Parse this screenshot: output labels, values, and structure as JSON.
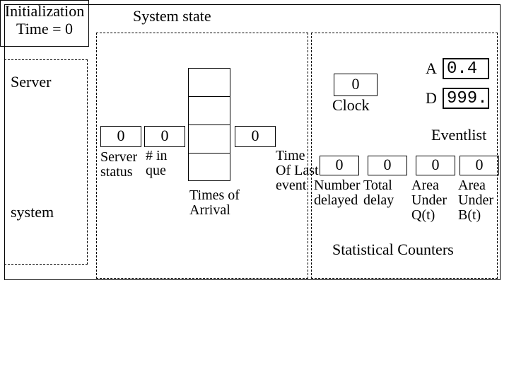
{
  "init": {
    "line1": "Initialization",
    "line2": "Time = 0"
  },
  "server_label": "Server",
  "system_label": "system",
  "system_state_title": "System state",
  "clock": {
    "value": "0",
    "label": "Clock"
  },
  "eventlist": {
    "a_label": "A",
    "a_value": "0.4",
    "d_label": "D",
    "d_value": "999.",
    "title": "Eventlist"
  },
  "row": {
    "server_status_value": "0",
    "in_queue_value": "0",
    "arrival_slot_value": "0",
    "server_status_label": "Server status",
    "in_queue_label": "# in que",
    "times_of_arrival_label": "Times of Arrival",
    "time_of_last_event_label": "Time Of Last event"
  },
  "stats": {
    "c1": {
      "value": "0",
      "label": "Number delayed"
    },
    "c2": {
      "value": "0",
      "label": "Total delay"
    },
    "c3": {
      "value": "0",
      "label": "Area Under Q(t)"
    },
    "c4": {
      "value": "0",
      "label": "Area Under B(t)"
    },
    "title": "Statistical Counters"
  }
}
